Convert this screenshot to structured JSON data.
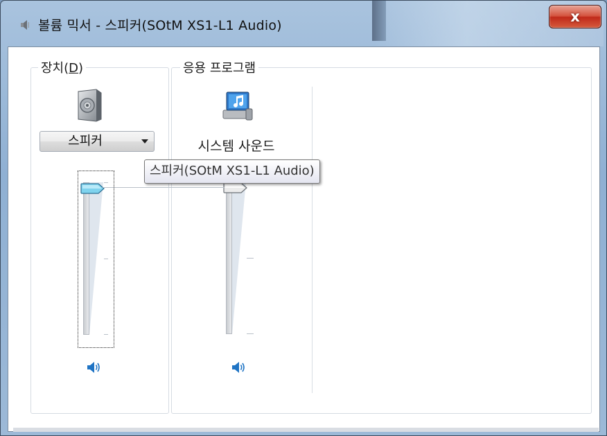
{
  "window": {
    "title": "볼륨 믹서 - 스피커(SOtM XS1-L1 Audio)",
    "close_label": "x",
    "title_icon": "speaker-small-icon"
  },
  "device_group": {
    "label_prefix": "장치(",
    "label_accel": "D",
    "label_suffix": ")",
    "device_icon": "speaker-device-icon",
    "device_select_value": "스피커",
    "volume_percent": 100,
    "mute_icon": "speaker-volume-icon"
  },
  "apps_group": {
    "label": "응용 프로그램",
    "apps": [
      {
        "name": "시스템 사운드",
        "icon": "system-sounds-icon",
        "volume_percent": 100,
        "mute_icon": "speaker-volume-icon"
      }
    ]
  },
  "tooltip": {
    "text": "스피커(SOtM XS1-L1 Audio)"
  },
  "colors": {
    "accent": "#1f74c4",
    "close_button": "#c9371f",
    "device_thumb": "#5fc6e6"
  }
}
